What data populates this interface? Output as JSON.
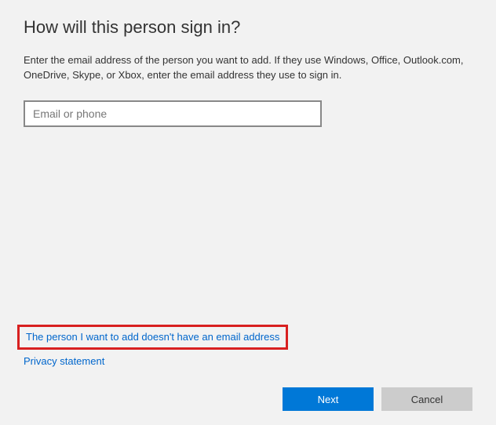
{
  "title": "How will this person sign in?",
  "description": "Enter the email address of the person you want to add. If they use Windows, Office, Outlook.com, OneDrive, Skype, or Xbox, enter the email address they use to sign in.",
  "email_input": {
    "placeholder": "Email or phone",
    "value": ""
  },
  "links": {
    "no_email": "The person I want to add doesn't have an email address",
    "privacy": "Privacy statement"
  },
  "buttons": {
    "next": "Next",
    "cancel": "Cancel"
  }
}
